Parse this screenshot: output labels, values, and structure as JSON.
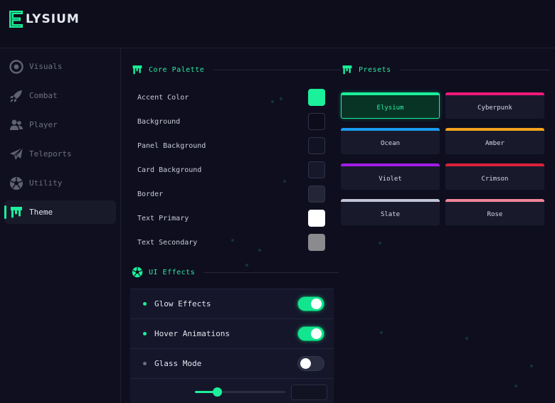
{
  "app": {
    "brand_initial": "E",
    "brand_name": "LYSIUM",
    "accent": "#1bf09a"
  },
  "sidebar": {
    "items": [
      {
        "label": "Visuals",
        "icon": "eye-target-icon",
        "active": false
      },
      {
        "label": "Combat",
        "icon": "rocket-icon",
        "active": false
      },
      {
        "label": "Player",
        "icon": "users-icon",
        "active": false
      },
      {
        "label": "Teleports",
        "icon": "paper-plane-icon",
        "active": false
      },
      {
        "label": "Utility",
        "icon": "soccer-ball-icon",
        "active": false
      },
      {
        "label": "Theme",
        "icon": "paint-drip-icon",
        "active": true
      }
    ]
  },
  "core_palette": {
    "title": "Core Palette",
    "rows": [
      {
        "label": "Accent Color",
        "color": "#1bf09a"
      },
      {
        "label": "Background",
        "color": "#0c0c1a"
      },
      {
        "label": "Panel Background",
        "color": "#121322"
      },
      {
        "label": "Card Background",
        "color": "#17182a"
      },
      {
        "label": "Border",
        "color": "#242636"
      },
      {
        "label": "Text Primary",
        "color": "#ffffff"
      },
      {
        "label": "Text Secondary",
        "color": "#8a8a8f"
      }
    ]
  },
  "ui_effects": {
    "title": "UI Effects",
    "rows": [
      {
        "label": "Glow Effects",
        "on": true
      },
      {
        "label": "Hover Animations",
        "on": true
      },
      {
        "label": "Glass Mode",
        "on": false
      }
    ]
  },
  "presets": {
    "title": "Presets",
    "items": [
      {
        "name": "Elysium",
        "color": "#1bf09a",
        "selected": true
      },
      {
        "name": "Cyberpunk",
        "color": "#f0187a",
        "selected": false
      },
      {
        "name": "Ocean",
        "color": "#1a9cf0",
        "selected": false
      },
      {
        "name": "Amber",
        "color": "#f3a31c",
        "selected": false
      },
      {
        "name": "Violet",
        "color": "#a21ce6",
        "selected": false
      },
      {
        "name": "Crimson",
        "color": "#d9223a",
        "selected": false
      },
      {
        "name": "Slate",
        "color": "#c0c4d6",
        "selected": false
      },
      {
        "name": "Rose",
        "color": "#f0869a",
        "selected": false
      }
    ]
  }
}
